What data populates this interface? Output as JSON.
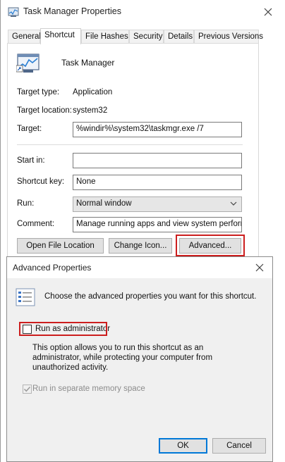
{
  "window": {
    "title": "Task Manager Properties",
    "tabs": [
      {
        "label": "General",
        "active": false
      },
      {
        "label": "Shortcut",
        "active": true
      },
      {
        "label": "File Hashes",
        "active": false
      },
      {
        "label": "Security",
        "active": false
      },
      {
        "label": "Details",
        "active": false
      },
      {
        "label": "Previous Versions",
        "active": false
      }
    ]
  },
  "shortcut": {
    "name": "Task Manager",
    "target_type_label": "Target type:",
    "target_type_value": "Application",
    "target_location_label": "Target location:",
    "target_location_value": "system32",
    "target_label": "Target:",
    "target_value": "%windir%\\system32\\taskmgr.exe /7",
    "start_in_label": "Start in:",
    "start_in_value": "",
    "shortcut_key_label": "Shortcut key:",
    "shortcut_key_value": "None",
    "run_label": "Run:",
    "run_value": "Normal window",
    "comment_label": "Comment:",
    "comment_value": "Manage running apps and view system performan",
    "open_file_location_label": "Open File Location",
    "change_icon_label": "Change Icon...",
    "advanced_label": "Advanced..."
  },
  "advanced": {
    "title": "Advanced Properties",
    "description": "Choose the advanced properties you want for this shortcut.",
    "run_as_admin_label": "Run as administrator",
    "run_as_admin_checked": false,
    "help_text": "This option allows you to run this shortcut as an administrator, while protecting your computer from unauthorized activity.",
    "separate_memory_label": "Run in separate memory space",
    "separate_memory_checked": true,
    "separate_memory_disabled": true,
    "ok_label": "OK",
    "cancel_label": "Cancel"
  },
  "colors": {
    "highlight": "#cc1e1e",
    "focus_blue": "#0078d7"
  },
  "icons": {
    "app": "task-manager-icon",
    "close": "close-icon",
    "dropdown": "chevron-down-icon",
    "properties": "properties-list-icon",
    "check": "checkmark-icon"
  }
}
